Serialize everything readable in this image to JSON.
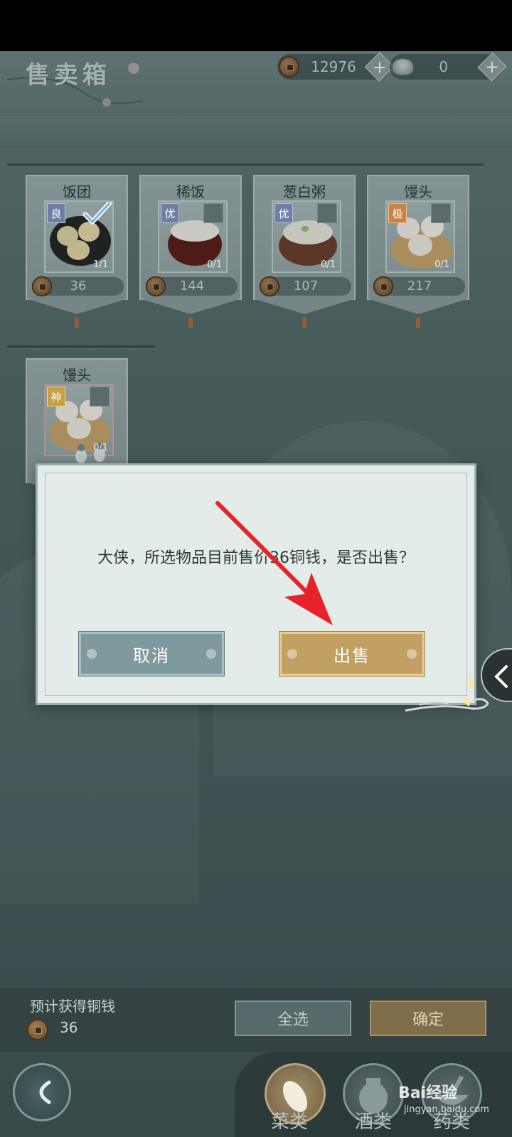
{
  "header": {
    "title": "售卖箱",
    "copper_amount": "12976",
    "silver_amount": "0"
  },
  "items": [
    {
      "name": "饭团",
      "grade": "良",
      "count": "1/1",
      "price": "36",
      "selected": true
    },
    {
      "name": "稀饭",
      "grade": "优",
      "count": "0/1",
      "price": "144",
      "selected": false
    },
    {
      "name": "葱白粥",
      "grade": "优",
      "count": "0/1",
      "price": "107",
      "selected": false
    },
    {
      "name": "馒头",
      "grade": "极",
      "count": "0/1",
      "price": "217",
      "selected": false
    },
    {
      "name": "馒头",
      "grade": "神",
      "count": "0/1",
      "price": "",
      "selected": false
    }
  ],
  "dialog": {
    "message": "大侠，所选物品目前售价36铜钱，是否出售？",
    "cancel_label": "取消",
    "confirm_label": "出售"
  },
  "footer": {
    "estimate_label": "预计获得铜钱",
    "estimate_value": "36",
    "select_all_label": "全选",
    "confirm_label": "确定"
  },
  "categories": [
    {
      "label": "菜类",
      "active": true
    },
    {
      "label": "酒类",
      "active": false
    },
    {
      "label": "药类",
      "active": false
    }
  ],
  "watermark": {
    "brand": "Bai经验",
    "url": "jingyan.baidu.com"
  },
  "colors": {
    "sell_button": "#c2a063",
    "cancel_button": "#7f9a9c",
    "annotation_arrow": "#e8222b"
  }
}
